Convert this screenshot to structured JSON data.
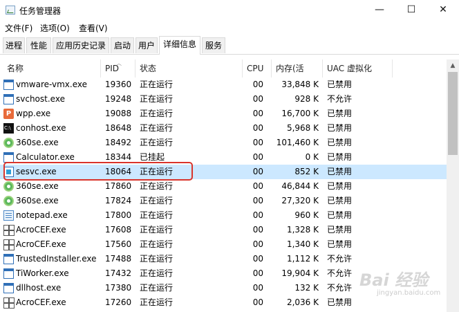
{
  "window": {
    "title": "任务管理器",
    "minimize_glyph": "—",
    "maximize_glyph": "☐",
    "close_glyph": "✕"
  },
  "menu": {
    "items": [
      "文件(F)",
      "选项(O)",
      "查看(V)"
    ]
  },
  "tabs": {
    "items": [
      "进程",
      "性能",
      "应用历史记录",
      "启动",
      "用户",
      "详细信息",
      "服务"
    ],
    "active": "详细信息"
  },
  "columns": {
    "name": "名称",
    "pid": "PID",
    "status": "状态",
    "cpu": "CPU",
    "memory": "内存(活动...",
    "uac": "UAC 虚拟化"
  },
  "rows": [
    {
      "name": "vmware-vmx.exe",
      "pid": "19360",
      "status": "正在运行",
      "cpu": "00",
      "memory": "33,848 K",
      "uac": "已禁用",
      "icon": "window-icon"
    },
    {
      "name": "svchost.exe",
      "pid": "19248",
      "status": "正在运行",
      "cpu": "00",
      "memory": "928 K",
      "uac": "不允许",
      "icon": "window-icon"
    },
    {
      "name": "wpp.exe",
      "pid": "19088",
      "status": "正在运行",
      "cpu": "00",
      "memory": "16,700 K",
      "uac": "已禁用",
      "icon": "ppt-icon"
    },
    {
      "name": "conhost.exe",
      "pid": "18648",
      "status": "正在运行",
      "cpu": "00",
      "memory": "5,968 K",
      "uac": "已禁用",
      "icon": "console-icon"
    },
    {
      "name": "360se.exe",
      "pid": "18492",
      "status": "正在运行",
      "cpu": "00",
      "memory": "101,460 K",
      "uac": "已禁用",
      "icon": "360-icon"
    },
    {
      "name": "Calculator.exe",
      "pid": "18344",
      "status": "已挂起",
      "cpu": "00",
      "memory": "0 K",
      "uac": "已禁用",
      "icon": "window-icon"
    },
    {
      "name": "sesvc.exe",
      "pid": "18064",
      "status": "正在运行",
      "cpu": "00",
      "memory": "852 K",
      "uac": "已禁用",
      "icon": "sesvc-icon"
    },
    {
      "name": "360se.exe",
      "pid": "17860",
      "status": "正在运行",
      "cpu": "00",
      "memory": "46,844 K",
      "uac": "已禁用",
      "icon": "360-icon"
    },
    {
      "name": "360se.exe",
      "pid": "17824",
      "status": "正在运行",
      "cpu": "00",
      "memory": "27,320 K",
      "uac": "已禁用",
      "icon": "360-icon"
    },
    {
      "name": "notepad.exe",
      "pid": "17800",
      "status": "正在运行",
      "cpu": "00",
      "memory": "960 K",
      "uac": "已禁用",
      "icon": "notepad-icon"
    },
    {
      "name": "AcroCEF.exe",
      "pid": "17608",
      "status": "正在运行",
      "cpu": "00",
      "memory": "1,328 K",
      "uac": "已禁用",
      "icon": "grid-icon"
    },
    {
      "name": "AcroCEF.exe",
      "pid": "17560",
      "status": "正在运行",
      "cpu": "00",
      "memory": "1,340 K",
      "uac": "已禁用",
      "icon": "grid-icon"
    },
    {
      "name": "TrustedInstaller.exe",
      "pid": "17488",
      "status": "正在运行",
      "cpu": "00",
      "memory": "1,112 K",
      "uac": "不允许",
      "icon": "window-icon"
    },
    {
      "name": "TiWorker.exe",
      "pid": "17432",
      "status": "正在运行",
      "cpu": "00",
      "memory": "19,904 K",
      "uac": "不允许",
      "icon": "window-icon"
    },
    {
      "name": "dllhost.exe",
      "pid": "17380",
      "status": "正在运行",
      "cpu": "00",
      "memory": "132 K",
      "uac": "不允许",
      "icon": "window-icon"
    },
    {
      "name": "AcroCEF.exe",
      "pid": "17260",
      "status": "正在运行",
      "cpu": "00",
      "memory": "2,036 K",
      "uac": "已禁用",
      "icon": "grid-icon"
    }
  ],
  "selected_row_name": "sesvc.exe",
  "watermark": {
    "text": "Bai 经验",
    "sub": "jingyan.baidu.com"
  }
}
